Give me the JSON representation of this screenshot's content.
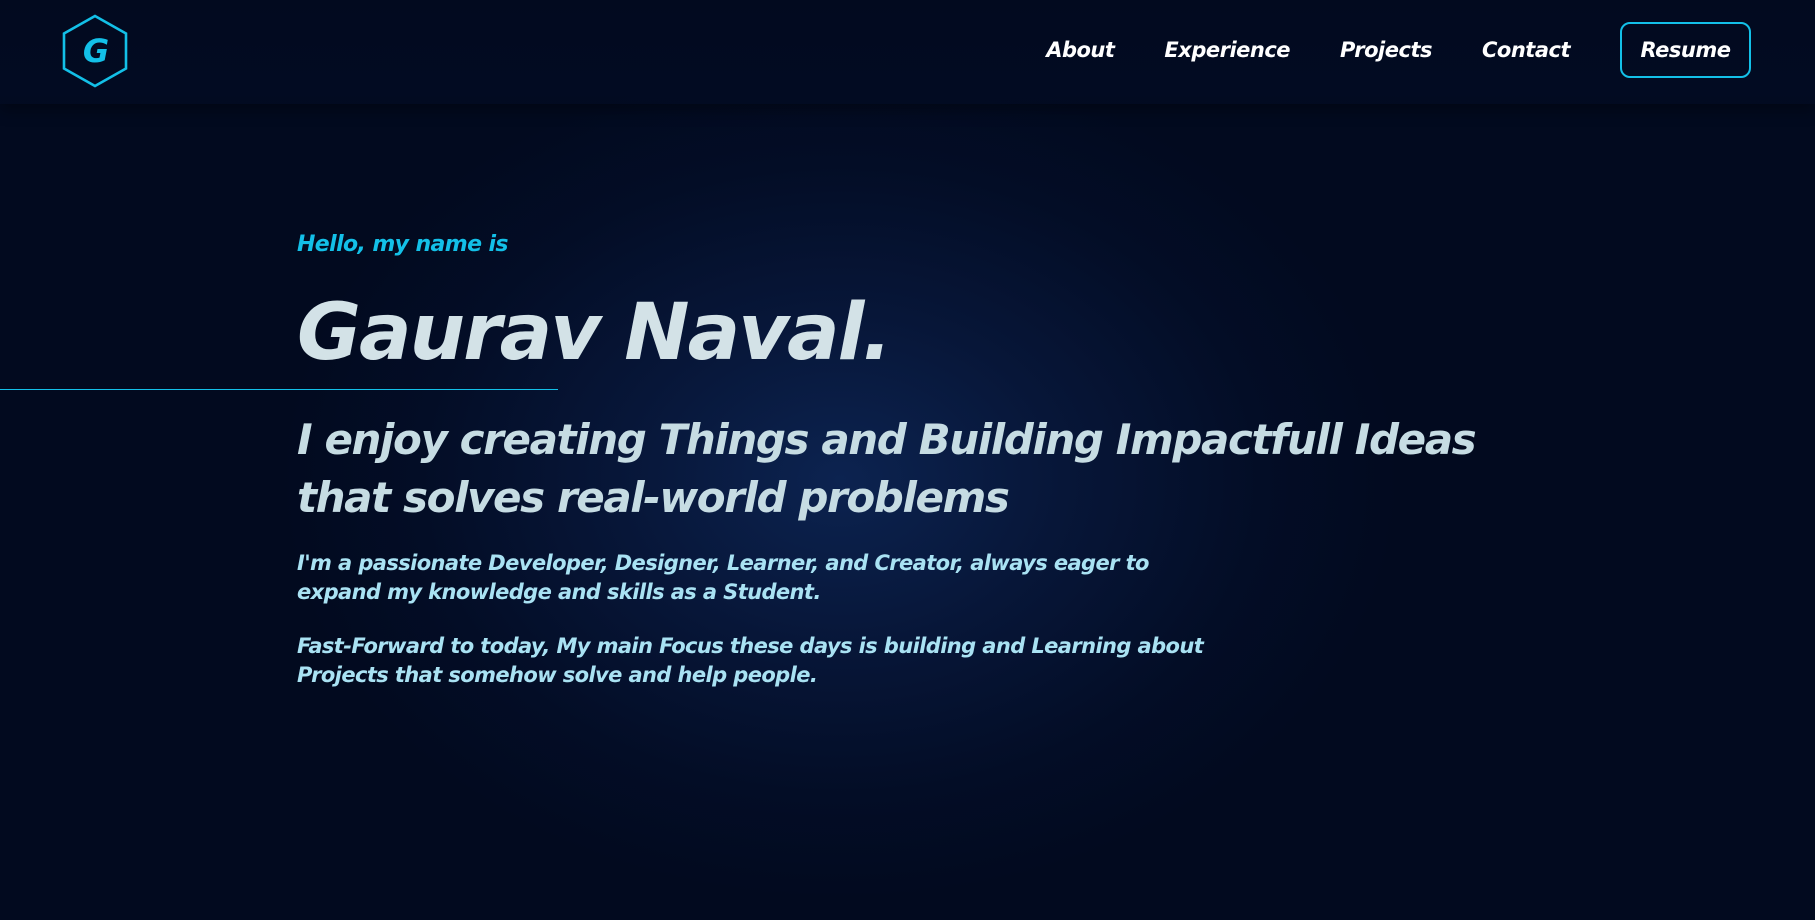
{
  "logo": {
    "letter": "G",
    "icon": "hexagon-logo-icon",
    "color": "#13c0e8"
  },
  "nav": {
    "items": [
      {
        "label": "About"
      },
      {
        "label": "Experience"
      },
      {
        "label": "Projects"
      },
      {
        "label": "Contact"
      }
    ],
    "resume_label": "Resume"
  },
  "hero": {
    "greeting": "Hello, my name is",
    "name": "Gaurav Naval.",
    "tagline": "I enjoy creating Things and Building Impactfull Ideas that solves real-world problems",
    "intro": "I'm a passionate Developer, Designer, Learner, and Creator, always eager to expand my knowledge and skills as a Student.",
    "focus": "Fast-Forward to today, My main Focus these days is building and Learning about Projects that somehow solve and help people."
  },
  "colors": {
    "accent": "#13c0e8",
    "background": "#020b20",
    "heading": "#d3e2e7",
    "body_text": "#a9e2f3"
  }
}
